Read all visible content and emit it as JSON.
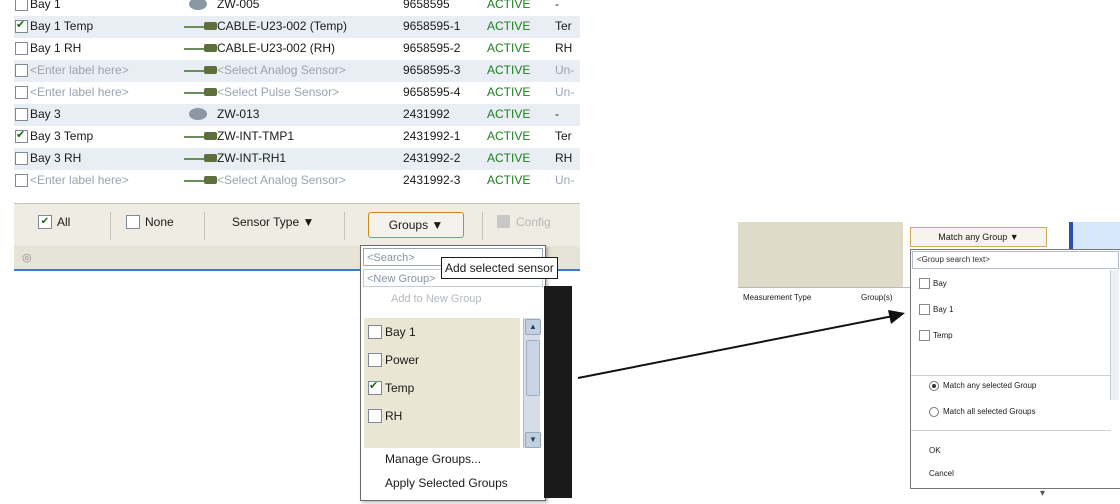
{
  "sensor_table": {
    "rows": [
      {
        "label": "Bay 1",
        "sensor": "ZW-005",
        "serial": "9658595",
        "status": "ACTIVE",
        "type": "-",
        "checked": false,
        "icon": "device",
        "dim": false
      },
      {
        "label": "Bay 1 Temp",
        "sensor": "CABLE-U23-002 (Temp)",
        "serial": "9658595-1",
        "status": "ACTIVE",
        "type": "Ter",
        "checked": true,
        "icon": "cable",
        "dim": false
      },
      {
        "label": "Bay 1 RH",
        "sensor": "CABLE-U23-002 (RH)",
        "serial": "9658595-2",
        "status": "ACTIVE",
        "type": "RH",
        "checked": false,
        "icon": "cable",
        "dim": false
      },
      {
        "label": "<Enter label here>",
        "sensor": "<Select Analog Sensor>",
        "serial": "9658595-3",
        "status": "ACTIVE",
        "type": "Un-",
        "checked": false,
        "icon": "cable",
        "dim": true
      },
      {
        "label": "<Enter label here>",
        "sensor": "<Select Pulse Sensor>",
        "serial": "9658595-4",
        "status": "ACTIVE",
        "type": "Un-",
        "checked": false,
        "icon": "cable",
        "dim": true
      },
      {
        "label": "Bay 3",
        "sensor": "ZW-013",
        "serial": "2431992",
        "status": "ACTIVE",
        "type": "-",
        "checked": false,
        "icon": "device",
        "dim": false
      },
      {
        "label": "Bay 3 Temp",
        "sensor": "ZW-INT-TMP1",
        "serial": "2431992-1",
        "status": "ACTIVE",
        "type": "Ter",
        "checked": true,
        "icon": "cable",
        "dim": false
      },
      {
        "label": "Bay 3 RH",
        "sensor": "ZW-INT-RH1",
        "serial": "2431992-2",
        "status": "ACTIVE",
        "type": "RH",
        "checked": false,
        "icon": "cable",
        "dim": false
      },
      {
        "label": "<Enter label here>",
        "sensor": "<Select Analog Sensor>",
        "serial": "2431992-3",
        "status": "ACTIVE",
        "type": "Un-",
        "checked": false,
        "icon": "cable",
        "dim": true
      }
    ]
  },
  "toolbar": {
    "all_label": "All",
    "none_label": "None",
    "sensor_type_label": "Sensor Type ▼",
    "groups_label": "Groups ▼",
    "configure_label": "Config"
  },
  "groups_dropdown": {
    "search_placeholder": "<Search>",
    "tooltip": "Add selected sensor",
    "new_group_placeholder": "<New Group>",
    "add_new_label": "Add to New Group",
    "items": [
      {
        "label": "Bay 1",
        "checked": false
      },
      {
        "label": "Power",
        "checked": false
      },
      {
        "label": "Temp",
        "checked": true
      },
      {
        "label": "RH",
        "checked": false
      }
    ],
    "manage_label": "Manage Groups...",
    "apply_label": "Apply Selected Groups"
  },
  "right_panel": {
    "col_measurement": "Measurement Type",
    "col_groups": "Group(s)",
    "match_button": "Match any Group ▼",
    "search_placeholder": "<Group search text>",
    "items": [
      {
        "label": "Bay",
        "checked": false
      },
      {
        "label": "Bay 1",
        "checked": false
      },
      {
        "label": "Temp",
        "checked": false
      }
    ],
    "radio_any": "Match any selected Group",
    "radio_all": "Match all selected Groups",
    "ok_label": "OK",
    "cancel_label": "Cancel"
  },
  "colors": {
    "status_green": "#1d7f1d",
    "toolbar_bg": "#eeece3",
    "accent_blue": "#3c78d8",
    "groups_button_border": "#c78b1d"
  }
}
